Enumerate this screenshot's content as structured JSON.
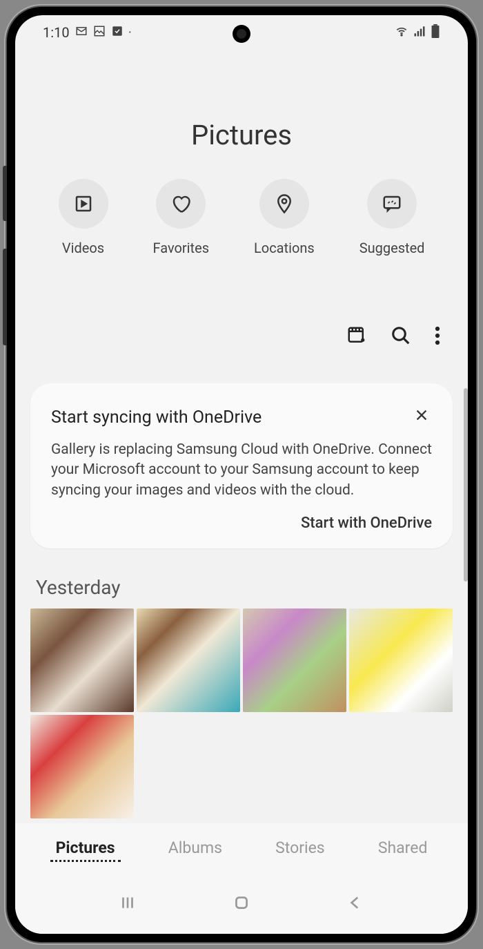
{
  "status": {
    "time": "1:10",
    "icons_left": [
      "gmail-icon",
      "image-icon",
      "check-icon",
      "dot-icon"
    ],
    "icons_right": [
      "wifi-icon",
      "signal-icon",
      "battery-icon"
    ]
  },
  "header": {
    "title": "Pictures"
  },
  "categories": [
    {
      "icon": "play-icon",
      "label": "Videos"
    },
    {
      "icon": "heart-icon",
      "label": "Favorites"
    },
    {
      "icon": "location-icon",
      "label": "Locations"
    },
    {
      "icon": "suggested-icon",
      "label": "Suggested"
    }
  ],
  "toolbar": {
    "icons": [
      "gif-create-icon",
      "search-icon",
      "more-icon"
    ]
  },
  "sync_card": {
    "title": "Start syncing with OneDrive",
    "body": "Gallery is replacing Samsung Cloud with OneDrive. Connect your Microsoft account to your Samsung account to keep syncing your images and videos with the cloud.",
    "action": "Start with OneDrive"
  },
  "sections": [
    {
      "header": "Yesterday",
      "photo_count": 5
    }
  ],
  "tabs": [
    {
      "label": "Pictures",
      "active": true
    },
    {
      "label": "Albums",
      "active": false
    },
    {
      "label": "Stories",
      "active": false
    },
    {
      "label": "Shared",
      "active": false
    }
  ],
  "nav": [
    "recents",
    "home",
    "back"
  ]
}
